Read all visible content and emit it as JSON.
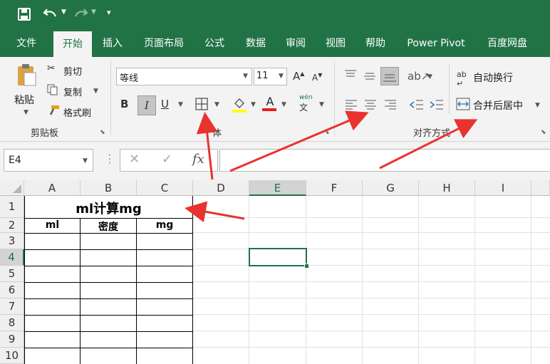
{
  "quick_access": {
    "save_icon": "save-icon",
    "undo_icon": "undo-icon",
    "redo_icon": "redo-icon",
    "customize_icon": "customize-icon"
  },
  "tabs": [
    "文件",
    "开始",
    "插入",
    "页面布局",
    "公式",
    "数据",
    "审阅",
    "视图",
    "帮助",
    "Power Pivot",
    "百度网盘"
  ],
  "ribbon": {
    "clipboard": {
      "paste": "粘贴",
      "cut": "剪切",
      "copy": "复制",
      "format_painter": "格式刷",
      "label": "剪贴板"
    },
    "font": {
      "name": "等线",
      "size": "11",
      "grow": "A",
      "shrink": "A",
      "bold": "B",
      "italic": "I",
      "underline": "U",
      "font_color": "A",
      "phonetic_top": "wén",
      "phonetic_bottom": "文",
      "label_partial": "体"
    },
    "alignment": {
      "wrap_text": "自动换行",
      "merge_center": "合并后居中",
      "label_partial": "对齐方式"
    }
  },
  "formula_bar": {
    "name_box": "E4",
    "fx": "fx",
    "formula": ""
  },
  "grid": {
    "columns": [
      "A",
      "B",
      "C",
      "D",
      "E",
      "F",
      "G",
      "H",
      "I"
    ],
    "rows": [
      "1",
      "2",
      "3",
      "4",
      "5",
      "6",
      "7",
      "8",
      "9",
      "10"
    ],
    "selected_cell": "E4",
    "merged_title": "ml计算mg",
    "headers": [
      "ml",
      "密度",
      "mg"
    ]
  },
  "colors": {
    "excel_green": "#217346",
    "arrow_red": "#e8332f",
    "selection_green": "#217346"
  }
}
